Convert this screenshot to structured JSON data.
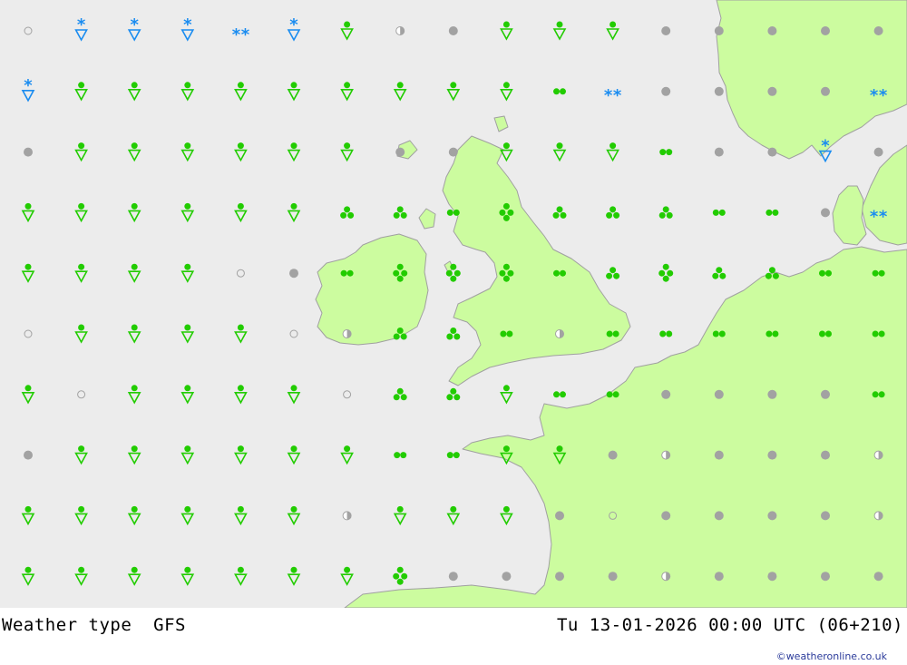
{
  "title": {
    "parameter": "Weather type",
    "model": "GFS",
    "valid_time": "Tu 13-01-2026 00:00 UTC (06+210)"
  },
  "credit": "©weatheronline.co.uk",
  "colors": {
    "sea": "#ececec",
    "land": "#ccfc9f",
    "coast": "#a0a0a0",
    "green_symbol": "#22cc00",
    "blue_symbol": "#1a8cf0",
    "grey_symbol": "#a2a2a2"
  },
  "legend_codes": {
    "o": "clear (open circle)",
    "c": "cloudy (grey dot)",
    "h": "partly cloudy (half dot)",
    "S": "rain shower",
    "d": "light rain (two dots)",
    "t": "rain (three dots)",
    "f": "heavy rain (four dots)",
    "Z": "snow shower",
    "z": "snow"
  },
  "grid_rows": [
    [
      "o",
      "Z",
      "Z",
      "Z",
      "z",
      "Z",
      "S",
      "h",
      "c",
      "S",
      "S",
      "S",
      "c",
      "c",
      "c",
      "c",
      "c",
      "c"
    ],
    [
      "Z",
      "S",
      "S",
      "S",
      "S",
      "S",
      "S",
      "S",
      "S",
      "S",
      "d",
      "z",
      "c",
      "c",
      "c",
      "c",
      "z",
      "z"
    ],
    [
      "c",
      "S",
      "S",
      "S",
      "S",
      "S",
      "S",
      "c",
      "c",
      "S",
      "S",
      "S",
      "d",
      "c",
      "c",
      "Z",
      "c",
      ""
    ],
    [
      "S",
      "S",
      "S",
      "S",
      "S",
      "S",
      "t",
      "t",
      "d",
      "f",
      "t",
      "t",
      "t",
      "d",
      "d",
      "c",
      "z",
      ""
    ],
    [
      "S",
      "S",
      "S",
      "S",
      "o",
      "c",
      "d",
      "f",
      "f",
      "f",
      "d",
      "t",
      "f",
      "t",
      "t",
      "d",
      "d",
      ""
    ],
    [
      "o",
      "S",
      "S",
      "S",
      "S",
      "o",
      "h",
      "t",
      "t",
      "d",
      "h",
      "d",
      "d",
      "d",
      "d",
      "d",
      "d",
      ""
    ],
    [
      "S",
      "o",
      "S",
      "S",
      "S",
      "S",
      "o",
      "t",
      "t",
      "S",
      "d",
      "d",
      "c",
      "c",
      "c",
      "c",
      "d",
      ""
    ],
    [
      "c",
      "S",
      "S",
      "S",
      "S",
      "S",
      "S",
      "d",
      "d",
      "S",
      "S",
      "c",
      "h",
      "c",
      "c",
      "c",
      "h",
      ""
    ],
    [
      "S",
      "S",
      "S",
      "S",
      "S",
      "S",
      "h",
      "S",
      "S",
      "S",
      "c",
      "o",
      "c",
      "c",
      "c",
      "c",
      "h",
      ""
    ],
    [
      "S",
      "S",
      "S",
      "S",
      "S",
      "S",
      "S",
      "f",
      "c",
      "c",
      "c",
      "c",
      "h",
      "c",
      "c",
      "c",
      "c",
      ""
    ]
  ]
}
